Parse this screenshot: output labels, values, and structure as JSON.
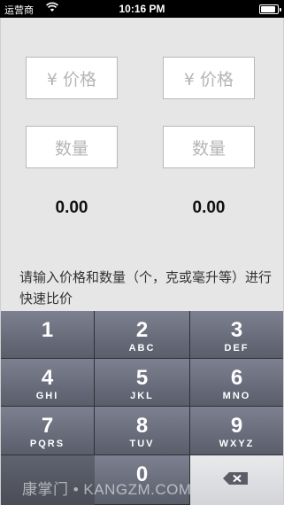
{
  "status_bar": {
    "carrier": "运营商",
    "time": "10:16 PM"
  },
  "inputs": {
    "left_price_placeholder": "¥ 价格",
    "right_price_placeholder": "¥ 价格",
    "left_quantity_placeholder": "数量",
    "right_quantity_placeholder": "数量"
  },
  "results": {
    "left_value": "0.00",
    "right_value": "0.00"
  },
  "hint_text": "请输入价格和数量（个，克或毫升等）进行快速比价",
  "keypad": {
    "keys": [
      {
        "num": "1",
        "letters": ""
      },
      {
        "num": "2",
        "letters": "ABC"
      },
      {
        "num": "3",
        "letters": "DEF"
      },
      {
        "num": "4",
        "letters": "GHI"
      },
      {
        "num": "5",
        "letters": "JKL"
      },
      {
        "num": "6",
        "letters": "MNO"
      },
      {
        "num": "7",
        "letters": "PQRS"
      },
      {
        "num": "8",
        "letters": "TUV"
      },
      {
        "num": "9",
        "letters": "WXYZ"
      },
      {
        "num": "0",
        "letters": ""
      }
    ]
  },
  "watermark": "康掌门 • KANGZM.COM"
}
